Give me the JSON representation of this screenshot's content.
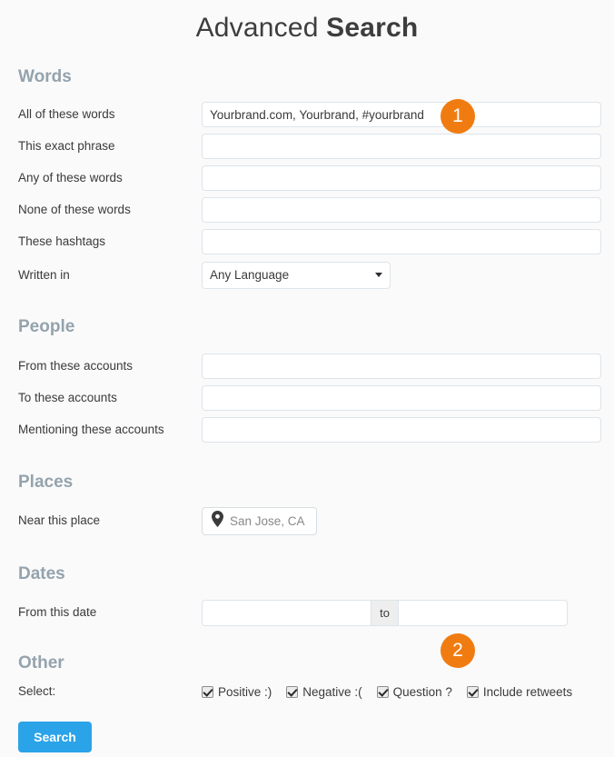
{
  "title": {
    "normal": "Advanced",
    "bold": "Search"
  },
  "sections": {
    "words": {
      "heading": "Words",
      "rows": [
        {
          "label": "All of these words",
          "value": "Yourbrand.com, Yourbrand, #yourbrand"
        },
        {
          "label": "This exact phrase",
          "value": ""
        },
        {
          "label": "Any of these words",
          "value": ""
        },
        {
          "label": "None of these words",
          "value": ""
        },
        {
          "label": "These hashtags",
          "value": ""
        }
      ],
      "language": {
        "label": "Written in",
        "selected": "Any Language",
        "caret_icon": "chevron-down-icon"
      }
    },
    "people": {
      "heading": "People",
      "rows": [
        {
          "label": "From these accounts",
          "value": ""
        },
        {
          "label": "To these accounts",
          "value": ""
        },
        {
          "label": "Mentioning these accounts",
          "value": ""
        }
      ]
    },
    "places": {
      "heading": "Places",
      "label": "Near this place",
      "value": "San Jose, CA",
      "pin_icon": "map-pin-icon"
    },
    "dates": {
      "heading": "Dates",
      "label": "From this date",
      "from_value": "",
      "separator": "to",
      "to_value": ""
    },
    "other": {
      "heading": "Other",
      "label": "Select:",
      "checkboxes": [
        {
          "label": "Positive :)",
          "checked": true
        },
        {
          "label": "Negative :(",
          "checked": true
        },
        {
          "label": "Question ?",
          "checked": true
        },
        {
          "label": "Include retweets",
          "checked": true
        }
      ]
    }
  },
  "search_button": {
    "label": "Search"
  },
  "badges": [
    {
      "number": "1"
    },
    {
      "number": "2"
    }
  ],
  "colors": {
    "accent_orange": "#f07c11",
    "button_blue": "#2ba3e8",
    "heading_grey": "#94a3ad",
    "background": "#fafafa"
  }
}
